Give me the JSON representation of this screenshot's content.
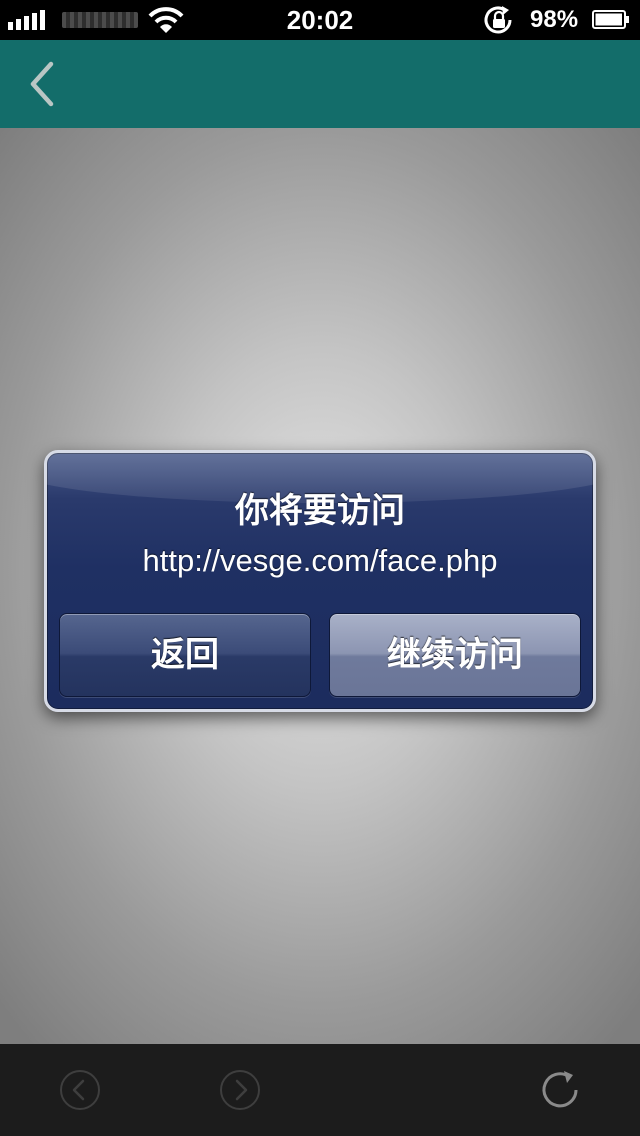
{
  "status_bar": {
    "time": "20:02",
    "battery_percent": "98%",
    "battery_level": 0.98,
    "signal_bars": 5,
    "icons": [
      "signal-icon",
      "wifi-icon",
      "rotation-lock-icon",
      "battery-icon"
    ]
  },
  "nav_bar": {
    "back_icon": "chevron-left-icon",
    "color": "#136d6a"
  },
  "alert": {
    "title": "你将要访问",
    "message": "http://vesge.com/face.php",
    "cancel_label": "返回",
    "continue_label": "继续访问"
  },
  "toolbar": {
    "icons": [
      "back-arrow-icon",
      "forward-arrow-icon",
      "refresh-icon"
    ]
  },
  "colors": {
    "nav_bar": "#136d6a",
    "alert_background": "#1f3063",
    "toolbar": "#1c1c1c"
  }
}
